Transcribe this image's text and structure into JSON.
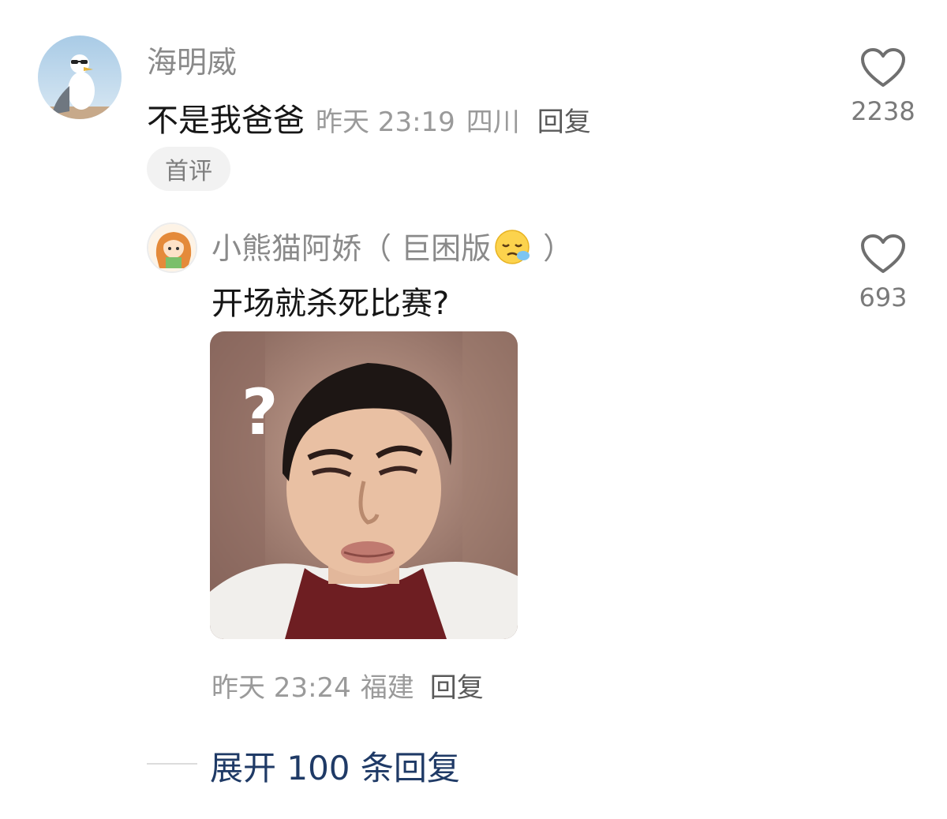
{
  "comment": {
    "username": "海明威",
    "text": "不是我爸爸",
    "time": "昨天 23:19",
    "location": "四川",
    "reply_label": "回复",
    "badge": "首评",
    "likes": "2238",
    "avatar_icon": "seagull-with-sunglasses-avatar"
  },
  "reply": {
    "username_prefix": "小熊猫阿娇（ 巨困版",
    "username_suffix": " ）",
    "emoji_icon": "sleepy-face-emoji",
    "text": "开场就杀死比赛?",
    "time": "昨天 23:24",
    "location": "福建",
    "reply_label": "回复",
    "likes": "693",
    "sticker_icon": "confused-man-meme-sticker",
    "sticker_question_mark": "?",
    "avatar_icon": "anime-girl-avatar"
  },
  "expand_label": "展开 100 条回复",
  "colors": {
    "accent_link": "#1f3a66",
    "meta_gray": "#9a9a9a",
    "text_dark": "#161616"
  }
}
